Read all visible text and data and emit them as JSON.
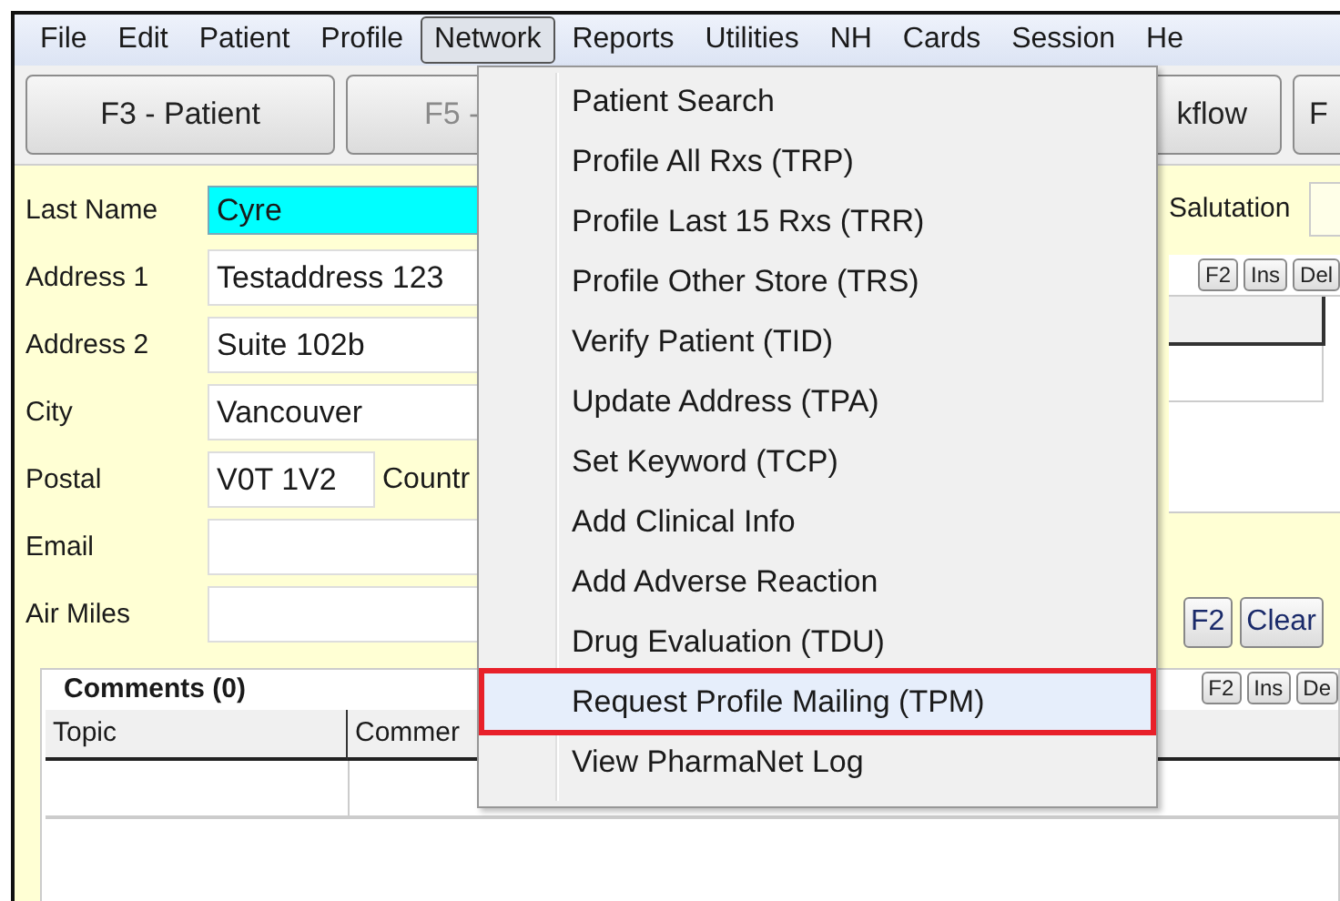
{
  "menu_bar": [
    {
      "label": "File",
      "selected": false
    },
    {
      "label": "Edit",
      "selected": false
    },
    {
      "label": "Patient",
      "selected": false
    },
    {
      "label": "Profile",
      "selected": false
    },
    {
      "label": "Network",
      "selected": true
    },
    {
      "label": "Reports",
      "selected": false
    },
    {
      "label": "Utilities",
      "selected": false
    },
    {
      "label": "NH",
      "selected": false
    },
    {
      "label": "Cards",
      "selected": false
    },
    {
      "label": "Session",
      "selected": false
    },
    {
      "label": "He",
      "selected": false
    }
  ],
  "toolbar": {
    "left": [
      {
        "label": "F3 - Patient",
        "disabled": false
      },
      {
        "label": "F5 -",
        "disabled": true
      }
    ],
    "right": [
      {
        "label": "kflow",
        "disabled": false
      },
      {
        "label": "F",
        "disabled": false
      }
    ]
  },
  "form": {
    "fields": [
      {
        "label": "Last Name",
        "value": "Cyre",
        "active": true
      },
      {
        "label": "Address 1",
        "value": "Testaddress 123",
        "active": false
      },
      {
        "label": "Address 2",
        "value": "Suite 102b",
        "active": false
      },
      {
        "label": "City",
        "value": "Vancouver",
        "active": false
      },
      {
        "label": "Postal",
        "value": "V0T 1V2",
        "active": false,
        "extra_label": "Countr"
      },
      {
        "label": "Email",
        "active": false
      },
      {
        "label": "Air Miles",
        "active": false
      }
    ]
  },
  "right_panel": {
    "salutation_label": "Salutation",
    "tool_buttons": [
      "F2",
      "Ins",
      "Del"
    ],
    "lookup_buttons": [
      "F2",
      "Clear"
    ]
  },
  "comments": {
    "title": "Comments (0)",
    "tool_buttons": [
      "F2",
      "Ins",
      "De"
    ],
    "columns": [
      "Topic",
      "Commer"
    ]
  },
  "network_menu": [
    {
      "label": "Patient Search",
      "selected": false
    },
    {
      "label": "Profile All Rxs (TRP)",
      "selected": false
    },
    {
      "label": "Profile Last 15 Rxs (TRR)",
      "selected": false
    },
    {
      "label": "Profile Other Store (TRS)",
      "selected": false
    },
    {
      "label": "Verify Patient (TID)",
      "selected": false
    },
    {
      "label": "Update Address (TPA)",
      "selected": false
    },
    {
      "label": "Set Keyword (TCP)",
      "selected": false
    },
    {
      "label": "Add Clinical Info",
      "selected": false
    },
    {
      "label": "Add Adverse Reaction",
      "selected": false
    },
    {
      "label": "Drug Evaluation (TDU)",
      "selected": false
    },
    {
      "label": "Request Profile Mailing (TPM)",
      "selected": true
    },
    {
      "label": "View PharmaNet Log",
      "selected": false
    }
  ]
}
